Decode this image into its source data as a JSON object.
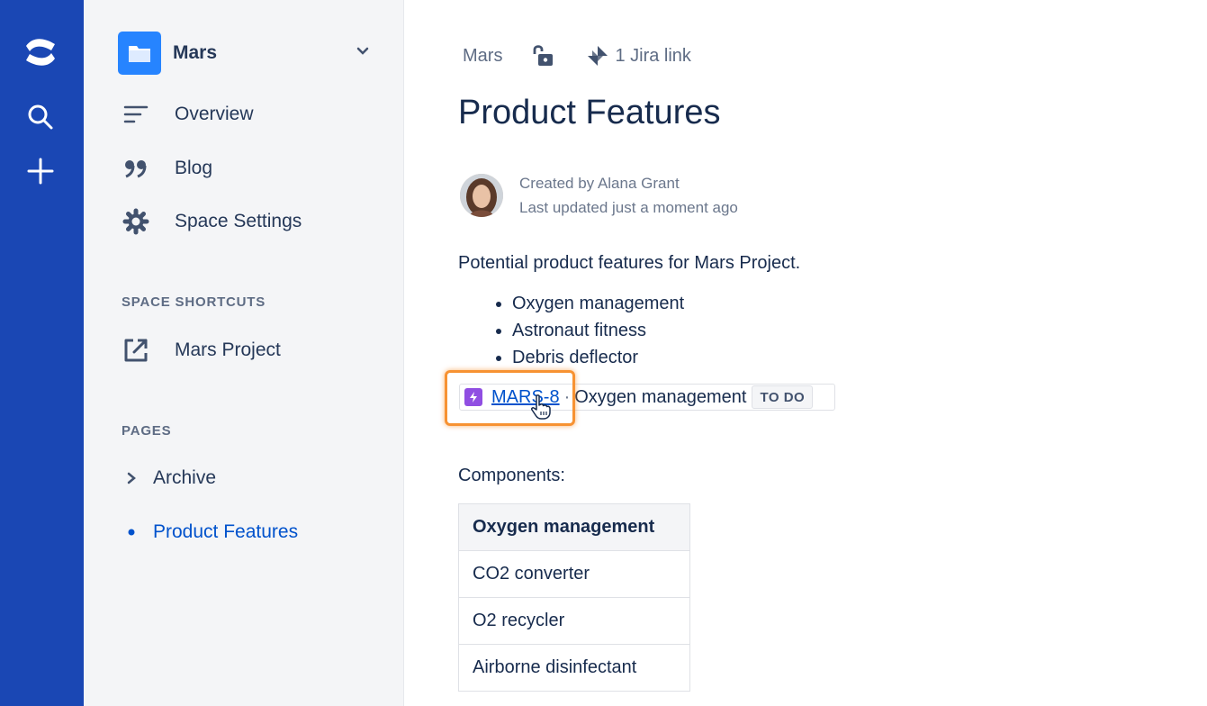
{
  "global_nav": {
    "logo_icon": "confluence-logo-icon",
    "search_icon": "search-icon",
    "create_icon": "plus-icon",
    "background_color": "#1a47b4"
  },
  "sidebar": {
    "space": {
      "name": "Mars",
      "icon": "folder-icon",
      "icon_color": "#2684ff"
    },
    "items": [
      {
        "label": "Overview",
        "icon": "overview-lines-icon"
      },
      {
        "label": "Blog",
        "icon": "quote-icon"
      },
      {
        "label": "Space Settings",
        "icon": "gear-icon"
      }
    ],
    "shortcuts_heading": "SPACE SHORTCUTS",
    "shortcuts": [
      {
        "label": "Mars Project",
        "icon": "external-link-icon"
      }
    ],
    "pages_heading": "PAGES",
    "pages": [
      {
        "label": "Archive",
        "icon": "chevron-right-icon",
        "active": false
      },
      {
        "label": "Product Features",
        "icon": "bullet-dot-icon",
        "active": true
      }
    ]
  },
  "page": {
    "breadcrumb": "Mars",
    "restrictions_icon": "unlocked-icon",
    "jira_link_text": "1 Jira link",
    "title": "Product Features",
    "byline": {
      "created_by": "Created by Alana Grant",
      "last_updated": "Last updated just a moment ago"
    },
    "intro": "Potential product features for Mars Project.",
    "features": [
      "Oxygen management",
      "Astronaut fitness",
      "Debris deflector"
    ],
    "jira_issue": {
      "key": "MARS-8",
      "separator": "·",
      "summary": "Oxygen management",
      "status": "TO DO",
      "type_icon": "epic-lightning-icon",
      "type_color": "#904ee2"
    },
    "components_label": "Components:",
    "components_table": {
      "header": "Oxygen management",
      "rows": [
        "CO2 converter",
        "O2 recycler",
        "Airborne disinfectant"
      ]
    },
    "highlight_color": "#f79232"
  }
}
